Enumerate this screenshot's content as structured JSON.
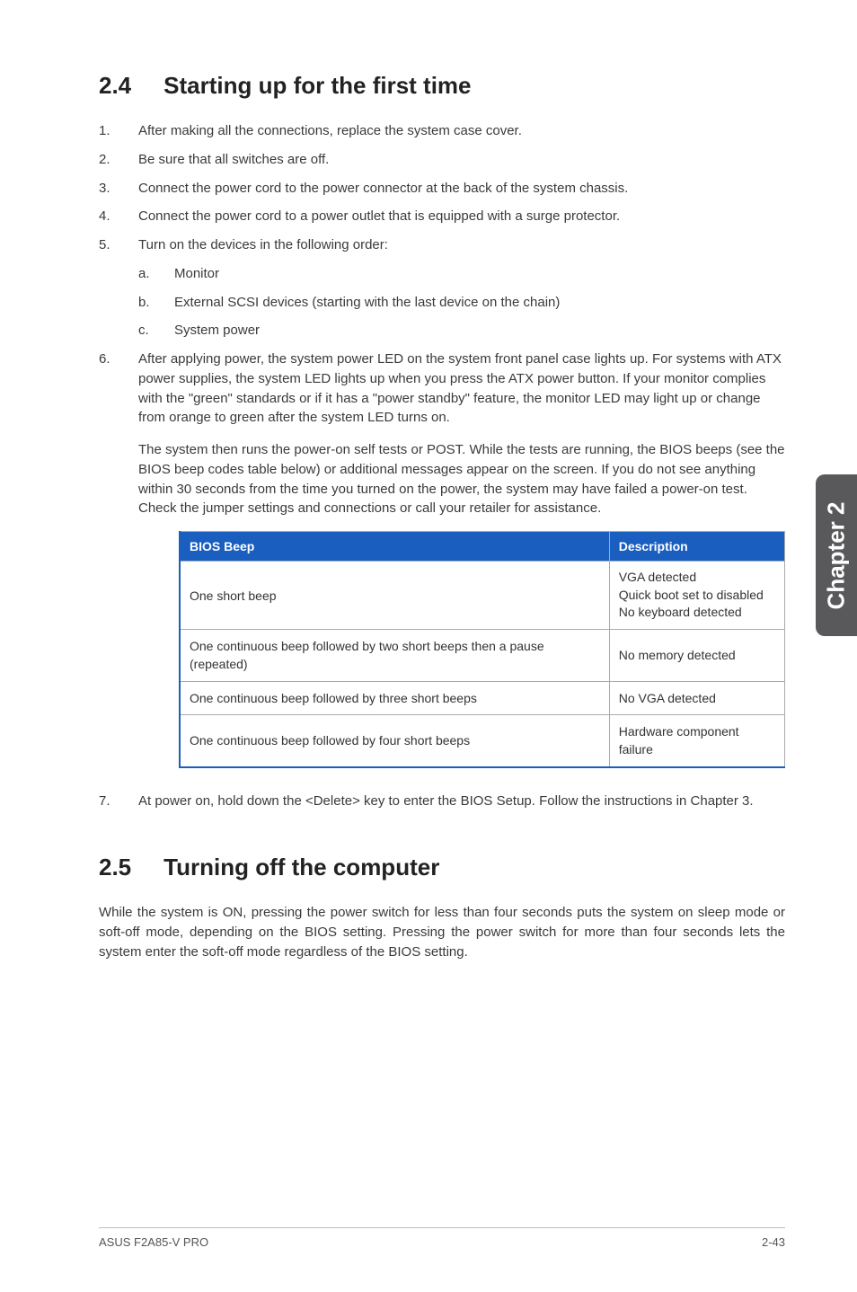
{
  "sideTab": "Chapter 2",
  "section24": {
    "num": "2.4",
    "title": "Starting up for the first time",
    "items": [
      {
        "num": "1.",
        "text": "After making all the connections, replace the system case cover."
      },
      {
        "num": "2.",
        "text": "Be sure that all switches are off."
      },
      {
        "num": "3.",
        "text": "Connect the power cord to the power connector at the back of the system chassis."
      },
      {
        "num": "4.",
        "text": "Connect the power cord to a power outlet that is equipped with a surge protector."
      },
      {
        "num": "5.",
        "text": "Turn on the devices in the following order:",
        "subitems": [
          {
            "letter": "a.",
            "text": "Monitor"
          },
          {
            "letter": "b.",
            "text": "External SCSI devices (starting with the last device on the chain)"
          },
          {
            "letter": "c.",
            "text": "System power"
          }
        ]
      },
      {
        "num": "6.",
        "text": "After applying power, the system power LED on the system front panel case lights up. For systems with ATX power supplies, the system LED lights up when you press the ATX power button. If your monitor complies with the \"green\" standards or if it has a \"power standby\" feature, the monitor LED may light up or change from orange to green after the system LED turns on.",
        "para2": "The system then runs the power-on self tests or POST. While the tests are running, the BIOS beeps (see the BIOS beep codes table below) or additional messages appear on the screen. If you do not see anything within 30 seconds from the time you turned on the power, the system may have failed a power-on test. Check the jumper settings and connections or call your retailer for assistance."
      }
    ],
    "tableHeaders": {
      "col1": "BIOS Beep",
      "col2": "Description"
    },
    "tableRows": [
      {
        "beep": "One short beep",
        "desc1": "VGA detected",
        "desc2": "Quick boot set to disabled",
        "desc3": "No keyboard detected"
      },
      {
        "beep": "One continuous beep followed by two short beeps then a pause (repeated)",
        "desc1": "No memory detected",
        "desc2": "",
        "desc3": ""
      },
      {
        "beep": "One continuous beep followed by three short beeps",
        "desc1": "No VGA detected",
        "desc2": "",
        "desc3": ""
      },
      {
        "beep": "One continuous beep followed by four short beeps",
        "desc1": "Hardware component failure",
        "desc2": "",
        "desc3": ""
      }
    ],
    "item7": {
      "num": "7.",
      "text": "At power on, hold down the <Delete> key to enter the BIOS Setup. Follow the instructions in Chapter 3."
    }
  },
  "section25": {
    "num": "2.5",
    "title": "Turning off the computer",
    "body": "While the system is ON, pressing the power switch for less than four seconds puts the system on sleep mode or soft-off mode, depending on the BIOS setting. Pressing the power switch for more than four seconds lets the system enter the soft-off mode regardless of the BIOS setting."
  },
  "footer": {
    "left": "ASUS F2A85-V PRO",
    "right": "2-43"
  }
}
